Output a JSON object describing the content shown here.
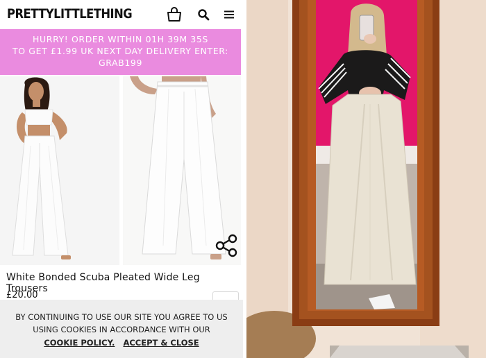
{
  "header": {
    "logo": "PRETTYLITTLETHING",
    "icons": [
      "shopping-bag-icon",
      "search-icon",
      "menu-icon"
    ]
  },
  "promo": {
    "line1": "HURRY! ORDER WITHIN  01H 39M 35S",
    "line2": "TO GET £1.99 UK NEXT DAY DELIVERY ENTER:",
    "line3": "GRAB199"
  },
  "product": {
    "title": "White Bonded Scuba Pleated Wide Leg Trousers",
    "price": "£20.00"
  },
  "cookie": {
    "line1": "BY CONTINUING TO USE OUR SITE YOU AGREE TO US",
    "line2": "USING COOKIES IN ACCORDANCE WITH OUR",
    "policy_link": "COOKIE POLICY.",
    "accept_link": "ACCEPT & CLOSE"
  },
  "colors": {
    "promo_banner": "#ea8bdf",
    "cookie_bar": "#eeeeee",
    "mirror_frame": "#8a3d14",
    "pink_wall": "#e3166a",
    "cream_wall": "#f1e3d6"
  }
}
